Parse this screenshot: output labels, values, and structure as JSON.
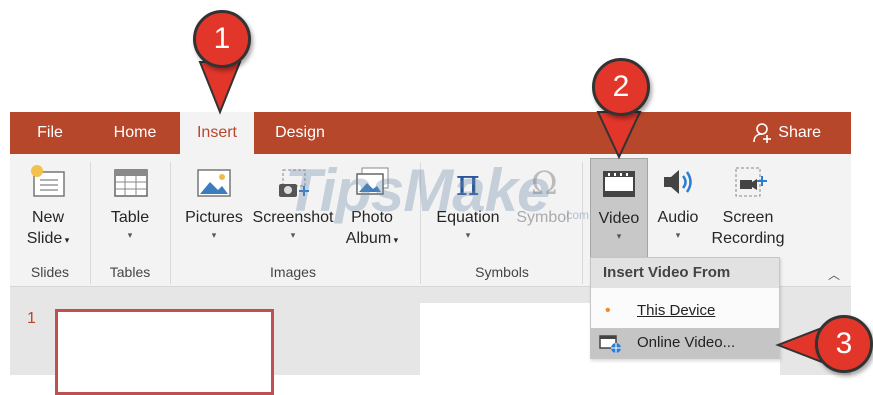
{
  "tabs": [
    {
      "label": "File"
    },
    {
      "label": "Home"
    },
    {
      "label": "Insert"
    },
    {
      "label": "Design"
    }
  ],
  "share_label": "Share",
  "groups": {
    "slides": {
      "label": "Slides",
      "new_slide_line1": "New",
      "new_slide_line2": "Slide"
    },
    "tables": {
      "label": "Tables",
      "table": "Table"
    },
    "images": {
      "label": "Images",
      "pictures": "Pictures",
      "screenshot": "Screenshot",
      "photo_album_line1": "Photo",
      "photo_album_line2": "Album"
    },
    "symbols": {
      "label": "Symbols",
      "equation": "Equation",
      "symbol": "Symbol"
    },
    "media": {
      "video": "Video",
      "audio": "Audio",
      "screen_recording_line1": "Screen",
      "screen_recording_line2": "Recording"
    }
  },
  "dropdown": {
    "header": "Insert Video From",
    "items": [
      {
        "label": "This Device"
      },
      {
        "label": "Online Video..."
      }
    ]
  },
  "slide_number": "1",
  "markers": [
    "1",
    "2",
    "3"
  ],
  "watermark": "TipsMake",
  "watermark_small": ".com",
  "colors": {
    "accent": "#b7472a",
    "marker": "#e2362b",
    "ribbon_bg": "#f3f3f3"
  }
}
